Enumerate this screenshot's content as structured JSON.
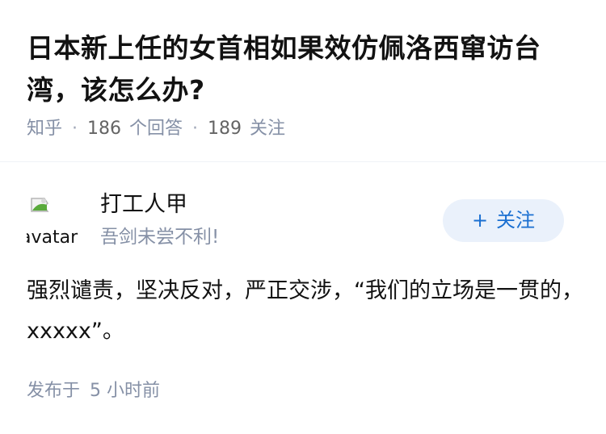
{
  "question": {
    "title": "日本新上任的女首相如果效仿佩洛西窜访台湾，该怎么办?",
    "source": "知乎",
    "answer_count": "186",
    "answer_label": "个回答",
    "follow_count": "189",
    "follow_label": "关注"
  },
  "answer": {
    "author": {
      "avatar_alt": "avatar",
      "name": "打工人甲",
      "bio": "吾剑未尝不利!"
    },
    "follow_button": {
      "icon": "+",
      "label": "关注"
    },
    "content": "强烈谴责，坚决反对，严正交涉，“我们的立场是一贯的，xxxxx”。",
    "published_prefix": "发布于",
    "published_time": "5 小时前"
  },
  "colors": {
    "title": "#121212",
    "meta": "#8590a6",
    "follow_bg": "#eaf1fb",
    "follow_text": "#1a6fd1"
  }
}
